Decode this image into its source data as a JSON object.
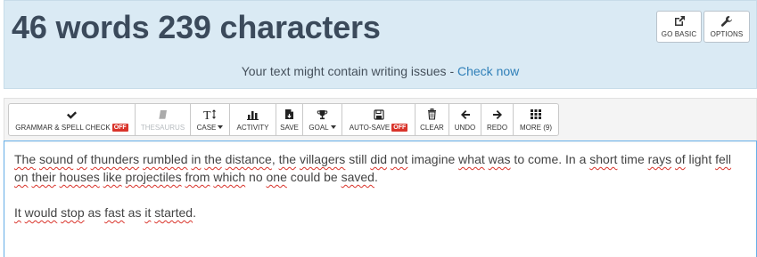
{
  "header": {
    "counter": "46 words 239 characters",
    "go_basic_label": "GO BASIC",
    "options_label": "OPTIONS",
    "notice_text": "Your text might contain writing issues - ",
    "notice_link": "Check now"
  },
  "toolbar": {
    "grammar_label": "GRAMMAR & SPELL CHECK",
    "grammar_badge": "OFF",
    "thesaurus_label": "THESAURUS",
    "case_label": "CASE",
    "activity_label": "ACTIVITY",
    "save_label": "SAVE",
    "goal_label": "GOAL",
    "autosave_label": "AUTO-SAVE",
    "autosave_badge": "OFF",
    "clear_label": "CLEAR",
    "undo_label": "UNDO",
    "redo_label": "REDO",
    "more_label": "MORE (9)"
  },
  "editor": {
    "paragraph1": [
      {
        "t": "The",
        "sq": true
      },
      {
        "t": " ",
        "sq": false
      },
      {
        "t": "sound",
        "sq": true
      },
      {
        "t": " ",
        "sq": false
      },
      {
        "t": "of",
        "sq": true
      },
      {
        "t": " ",
        "sq": false
      },
      {
        "t": "thunders",
        "sq": true
      },
      {
        "t": " ",
        "sq": false
      },
      {
        "t": "rumbled",
        "sq": true
      },
      {
        "t": " ",
        "sq": false
      },
      {
        "t": "in",
        "sq": true
      },
      {
        "t": " ",
        "sq": false
      },
      {
        "t": "the",
        "sq": true
      },
      {
        "t": " ",
        "sq": false
      },
      {
        "t": "distance",
        "sq": true
      },
      {
        "t": ", ",
        "sq": false
      },
      {
        "t": "the",
        "sq": true
      },
      {
        "t": " ",
        "sq": false
      },
      {
        "t": "villagers",
        "sq": true
      },
      {
        "t": " still ",
        "sq": false
      },
      {
        "t": "did",
        "sq": true
      },
      {
        "t": " ",
        "sq": false
      },
      {
        "t": "not",
        "sq": true
      },
      {
        "t": " imagine ",
        "sq": false
      },
      {
        "t": "what",
        "sq": true
      },
      {
        "t": " ",
        "sq": false
      },
      {
        "t": "was",
        "sq": true
      },
      {
        "t": " to come. In a ",
        "sq": false
      },
      {
        "t": "short",
        "sq": true
      },
      {
        "t": " time ",
        "sq": false
      },
      {
        "t": "rays",
        "sq": true
      },
      {
        "t": " ",
        "sq": false
      },
      {
        "t": "of",
        "sq": true
      },
      {
        "t": " light ",
        "sq": false
      },
      {
        "t": "fell",
        "sq": true
      },
      {
        "t": " ",
        "sq": false
      },
      {
        "t": "on",
        "sq": true
      },
      {
        "t": " ",
        "sq": false
      },
      {
        "t": "their",
        "sq": true
      },
      {
        "t": " ",
        "sq": false
      },
      {
        "t": "houses",
        "sq": true
      },
      {
        "t": " ",
        "sq": false
      },
      {
        "t": "like",
        "sq": true
      },
      {
        "t": " ",
        "sq": false
      },
      {
        "t": "projectiles",
        "sq": true
      },
      {
        "t": " ",
        "sq": false
      },
      {
        "t": "from",
        "sq": true
      },
      {
        "t": " ",
        "sq": false
      },
      {
        "t": "which",
        "sq": true
      },
      {
        "t": " no ",
        "sq": false
      },
      {
        "t": "one",
        "sq": true
      },
      {
        "t": " could be ",
        "sq": false
      },
      {
        "t": "saved",
        "sq": true
      },
      {
        "t": ".",
        "sq": false
      }
    ],
    "paragraph2": [
      {
        "t": "It",
        "sq": true
      },
      {
        "t": " ",
        "sq": false
      },
      {
        "t": "would",
        "sq": true
      },
      {
        "t": " ",
        "sq": false
      },
      {
        "t": "stop",
        "sq": true
      },
      {
        "t": " as ",
        "sq": false
      },
      {
        "t": "fast",
        "sq": true
      },
      {
        "t": " as ",
        "sq": false
      },
      {
        "t": "it",
        "sq": true
      },
      {
        "t": " ",
        "sq": false
      },
      {
        "t": "started",
        "sq": true
      },
      {
        "t": ".",
        "sq": false
      }
    ]
  },
  "colors": {
    "header_bg": "#daeaf4",
    "counter": "#3b4a5b",
    "link": "#2f7fb8",
    "badge_off": "#d9342b",
    "editor_border": "#66afe9"
  },
  "icons": [
    "external-link-icon",
    "wrench-icon",
    "check-icon",
    "book-icon",
    "text-case-icon",
    "bar-chart-icon",
    "save-file-icon",
    "trophy-icon",
    "floppy-disk-icon",
    "trash-icon",
    "arrow-left-icon",
    "arrow-right-icon",
    "grid-icon"
  ]
}
